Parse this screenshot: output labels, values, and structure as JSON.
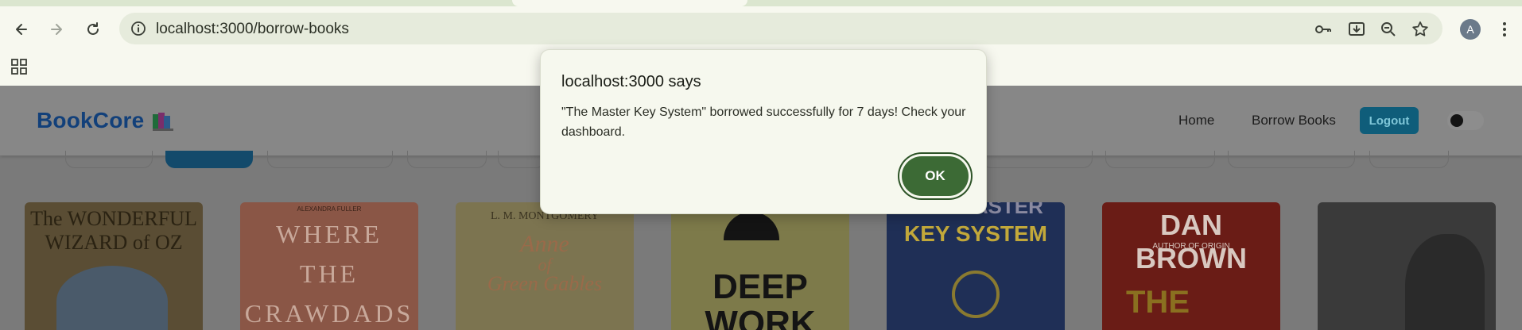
{
  "browser": {
    "url": "localhost:3000/borrow-books",
    "profile_initial": "A",
    "icons": [
      "back-icon",
      "forward-icon",
      "reload-icon",
      "info-icon",
      "password-key-icon",
      "install-app-icon",
      "zoom-out-icon",
      "bookmark-star-icon",
      "more-menu-icon",
      "apps-grid-icon"
    ]
  },
  "site": {
    "logo": "BookCore",
    "nav": {
      "home": "Home",
      "borrow": "Borrow Books",
      "logout": "Logout"
    },
    "theme_toggle_on": false
  },
  "books": [
    {
      "title_lines": [
        "The WONDERFUL",
        "WIZARD of OZ"
      ],
      "color": "#5a4d34"
    },
    {
      "author_note": "ALEXANDRA FULLER",
      "title_lines": [
        "WHERE",
        "THE",
        "CRAWDADS"
      ],
      "color": "#8a5646"
    },
    {
      "author": "L. M. MONTGOMERY",
      "title_lines": [
        "Anne",
        "of",
        "Green Gables"
      ],
      "color": "#7c7450"
    },
    {
      "title_lines": [
        "DEEP",
        "WORK"
      ],
      "color": "#7d7a4a"
    },
    {
      "title_lines": [
        "MASTER",
        "KEY SYSTEM"
      ],
      "color": "#1f2f56"
    },
    {
      "title_lines": [
        "DAN BROWN",
        "AUTHOR OF ORIGIN",
        "THE"
      ],
      "color": "#6a1c16"
    },
    {
      "title_lines": [],
      "color": "#3a3a3a"
    }
  ],
  "dialog": {
    "title": "localhost:3000 says",
    "message": "\"The Master Key System\" borrowed successfully for 7 days! Check your dashboard.",
    "ok_label": "OK"
  },
  "colors": {
    "accent_ok": "#3c6a35",
    "logo_blue": "#12407a"
  }
}
